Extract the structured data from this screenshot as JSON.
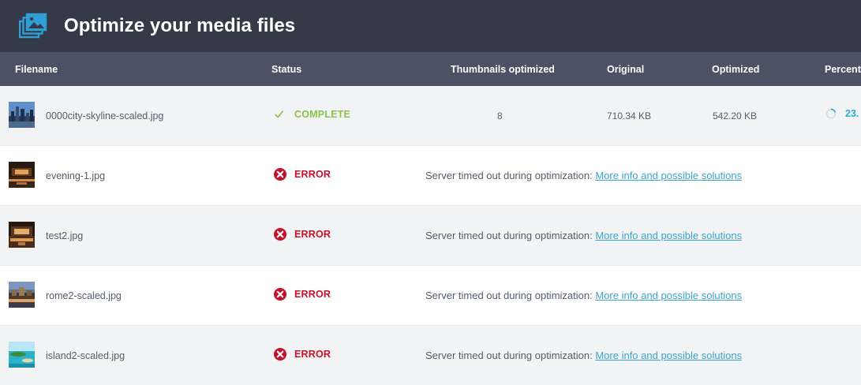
{
  "header": {
    "title": "Optimize your media files",
    "icon": "media-library-icon",
    "background": "#343a48"
  },
  "table": {
    "columns": {
      "filename": "Filename",
      "status": "Status",
      "thumbnails": "Thumbnails optimized",
      "original": "Original",
      "optimized": "Optimized",
      "percentage": "Percenta"
    },
    "rows": [
      {
        "filename": "0000city-skyline-scaled.jpg",
        "status": "COMPLETE",
        "status_icon": "checkmark-icon",
        "thumbnails": "8",
        "original": "710.34 KB",
        "optimized": "542.20 KB",
        "percentage": "23."
      },
      {
        "filename": "evening-1.jpg",
        "status": "ERROR",
        "status_icon": "error-circle-icon",
        "message": "Server timed out during optimization:",
        "link": "More info and possible solutions"
      },
      {
        "filename": "test2.jpg",
        "status": "ERROR",
        "status_icon": "error-circle-icon",
        "message": "Server timed out during optimization:",
        "link": "More info and possible solutions"
      },
      {
        "filename": "rome2-scaled.jpg",
        "status": "ERROR",
        "status_icon": "error-circle-icon",
        "message": "Server timed out during optimization:",
        "link": "More info and possible solutions"
      },
      {
        "filename": "island2-scaled.jpg",
        "status": "ERROR",
        "status_icon": "error-circle-icon",
        "message": "Server timed out during optimization:",
        "link": "More info and possible solutions"
      }
    ]
  },
  "colors": {
    "complete": "#8bc34a",
    "error": "#c9102a",
    "link": "#3aa6cf",
    "accent": "#2eaec7"
  }
}
